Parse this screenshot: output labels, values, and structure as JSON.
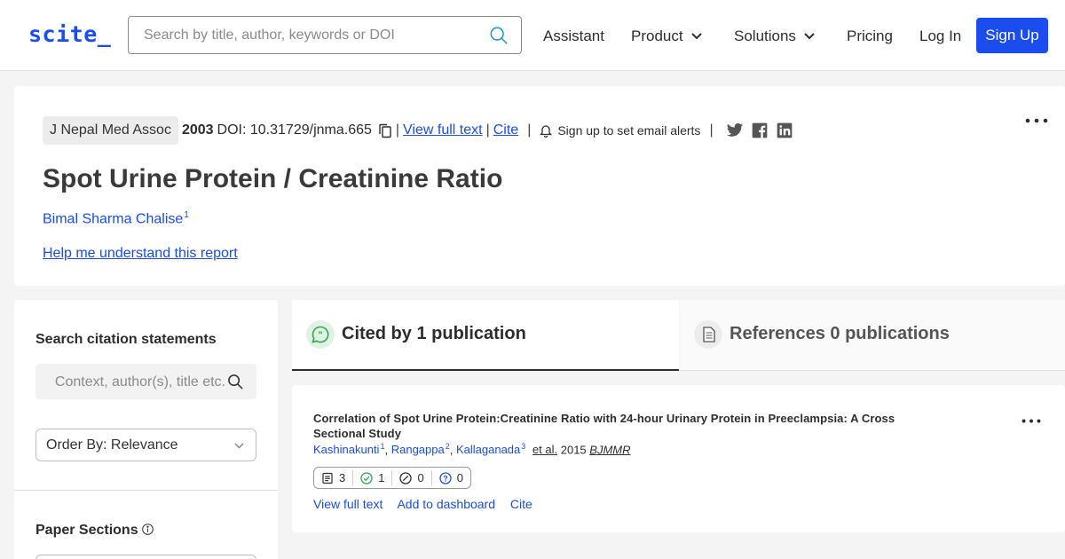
{
  "nav": {
    "logo": "scite_",
    "search_placeholder": "Search by title, author, keywords or DOI",
    "links": {
      "assistant": "Assistant",
      "product": "Product",
      "solutions": "Solutions",
      "pricing": "Pricing",
      "login": "Log In"
    },
    "signup": "Sign Up"
  },
  "paper": {
    "journal": "J Nepal Med Assoc",
    "year": "2003",
    "doi": "DOI: 10.31729/jnma.665",
    "view_full_text": "View full text",
    "cite": "Cite",
    "alerts": "Sign up to set email alerts",
    "title": "Spot Urine Protein / Creatinine Ratio",
    "author": "Bimal Sharma Chalise",
    "author_sup": "1",
    "help_link": "Help me understand this report",
    "separator": "|"
  },
  "sidebar": {
    "search_heading": "Search citation statements",
    "search_placeholder": "Context, author(s), title etc.",
    "order_by": "Order By: Relevance",
    "sections_heading": "Paper Sections"
  },
  "tabs": {
    "cited": "Cited by 1 publication",
    "references": "References 0 publications"
  },
  "result": {
    "title": "Correlation of Spot Urine Protein:Creatinine Ratio with 24-hour Urinary Protein in Preeclampsia: A Cross Sectional Study",
    "authors": [
      {
        "name": "Kashinakunti",
        "sup": "1"
      },
      {
        "name": "Rangappa",
        "sup": "2"
      },
      {
        "name": "Kallaganada",
        "sup": "3"
      }
    ],
    "comma": ",",
    "et_al": "et al.",
    "year": "2015",
    "journal": "BJMMR",
    "tally": {
      "mentioning": "3",
      "supporting": "1",
      "contrasting": "0",
      "uncertain": "0"
    },
    "actions": {
      "view_full_text": "View full text",
      "add_to_dashboard": "Add to dashboard",
      "cite": "Cite"
    }
  },
  "colors": {
    "brand": "#1a4cf0",
    "supporting": "#2fa84f",
    "uncertain": "#1a4cf0"
  }
}
